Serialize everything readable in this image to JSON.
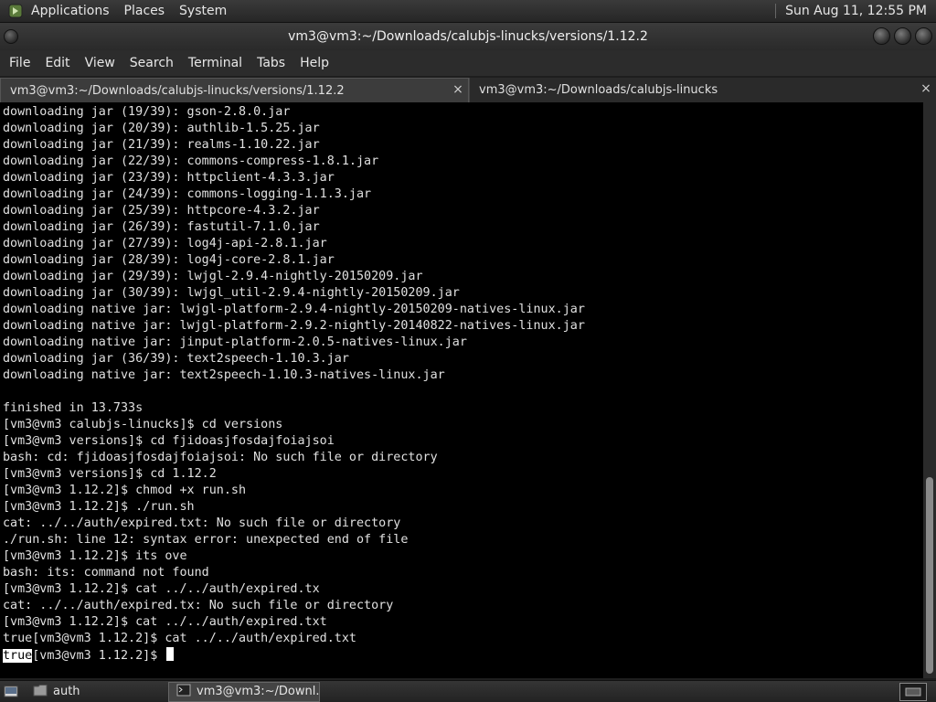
{
  "top_panel": {
    "menus": [
      "Applications",
      "Places",
      "System"
    ],
    "clock": "Sun Aug 11, 12:55 PM",
    "apps_icon": "gnome-foot-icon"
  },
  "window": {
    "title": "vm3@vm3:~/Downloads/calubjs-linucks/versions/1.12.2"
  },
  "menubar": [
    "File",
    "Edit",
    "View",
    "Search",
    "Terminal",
    "Tabs",
    "Help"
  ],
  "tabs": [
    {
      "label": "vm3@vm3:~/Downloads/calubjs-linucks/versions/1.12.2",
      "active": true,
      "close": "×"
    },
    {
      "label": "vm3@vm3:~/Downloads/calubjs-linucks",
      "active": false,
      "close": "×"
    }
  ],
  "terminal": {
    "lines": [
      "downloading jar (19/39): gson-2.8.0.jar",
      "downloading jar (20/39): authlib-1.5.25.jar",
      "downloading jar (21/39): realms-1.10.22.jar",
      "downloading jar (22/39): commons-compress-1.8.1.jar",
      "downloading jar (23/39): httpclient-4.3.3.jar",
      "downloading jar (24/39): commons-logging-1.1.3.jar",
      "downloading jar (25/39): httpcore-4.3.2.jar",
      "downloading jar (26/39): fastutil-7.1.0.jar",
      "downloading jar (27/39): log4j-api-2.8.1.jar",
      "downloading jar (28/39): log4j-core-2.8.1.jar",
      "downloading jar (29/39): lwjgl-2.9.4-nightly-20150209.jar",
      "downloading jar (30/39): lwjgl_util-2.9.4-nightly-20150209.jar",
      "downloading native jar: lwjgl-platform-2.9.4-nightly-20150209-natives-linux.jar",
      "downloading native jar: lwjgl-platform-2.9.2-nightly-20140822-natives-linux.jar",
      "downloading native jar: jinput-platform-2.0.5-natives-linux.jar",
      "downloading jar (36/39): text2speech-1.10.3.jar",
      "downloading native jar: text2speech-1.10.3-natives-linux.jar",
      "",
      "finished in 13.733s",
      "[vm3@vm3 calubjs-linucks]$ cd versions",
      "[vm3@vm3 versions]$ cd fjidoasjfosdajfoiajsoi",
      "bash: cd: fjidoasjfosdajfoiajsoi: No such file or directory",
      "[vm3@vm3 versions]$ cd 1.12.2",
      "[vm3@vm3 1.12.2]$ chmod +x run.sh",
      "[vm3@vm3 1.12.2]$ ./run.sh",
      "cat: ../../auth/expired.txt: No such file or directory",
      "./run.sh: line 12: syntax error: unexpected end of file",
      "[vm3@vm3 1.12.2]$ its ove",
      "bash: its: command not found",
      "[vm3@vm3 1.12.2]$ cat ../../auth/expired.tx",
      "cat: ../../auth/expired.tx: No such file or directory",
      "[vm3@vm3 1.12.2]$ cat ../../auth/expired.txt",
      "true[vm3@vm3 1.12.2]$ cat ../../auth/expired.txt"
    ],
    "last_line_selected": "true",
    "last_line_rest": "[vm3@vm3 1.12.2]$ "
  },
  "scrollbar": {
    "position_fraction": 0.97
  },
  "bottom_panel": {
    "tasks": [
      {
        "label": "auth",
        "icon": "folder-icon",
        "active": false
      },
      {
        "label": "vm3@vm3:~/Downl...",
        "icon": "terminal-icon",
        "active": true
      }
    ]
  }
}
